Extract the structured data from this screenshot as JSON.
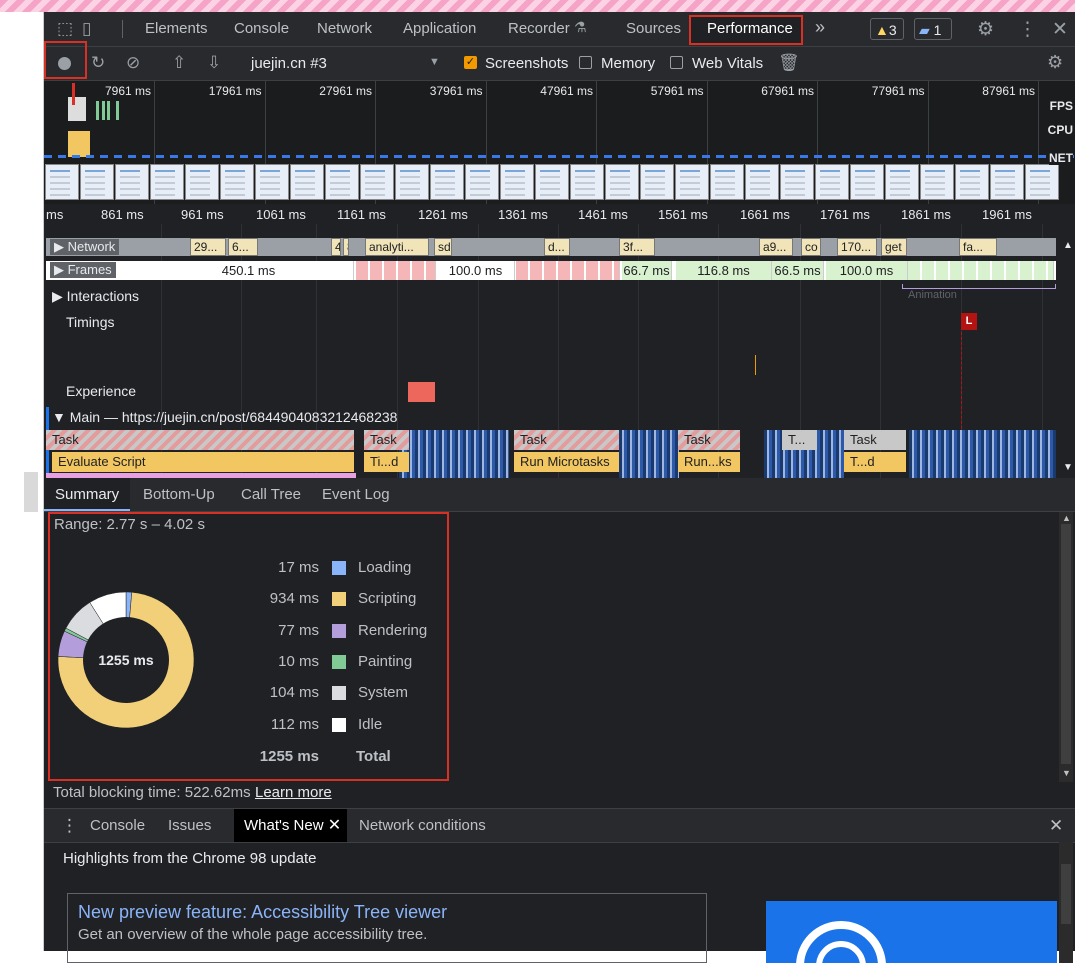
{
  "tabs": {
    "elements": "Elements",
    "console": "Console",
    "network": "Network",
    "application": "Application",
    "recorder": "Recorder",
    "recorder_icon": "flask-icon",
    "sources": "Sources",
    "performance": "Performance",
    "more": "»",
    "warnings_count": "3",
    "messages_count": "1"
  },
  "perf_toolbar": {
    "profile_select": "juejin.cn #3",
    "screenshots_label": "Screenshots",
    "screenshots_checked": true,
    "memory_label": "Memory",
    "memory_checked": false,
    "webvitals_label": "Web Vitals",
    "webvitals_checked": false
  },
  "overview": {
    "ticks": [
      "7961 ms",
      "17961 ms",
      "27961 ms",
      "37961 ms",
      "47961 ms",
      "57961 ms",
      "67961 ms",
      "77961 ms",
      "87961 ms"
    ],
    "labels": {
      "fps": "FPS",
      "cpu": "CPU",
      "net": "NET"
    }
  },
  "flame": {
    "ticks": [
      "ms",
      "861 ms",
      "961 ms",
      "1061 ms",
      "1161 ms",
      "1261 ms",
      "1361 ms",
      "1461 ms",
      "1561 ms",
      "1661 ms",
      "1761 ms",
      "1861 ms",
      "1961 ms"
    ],
    "network_label": "Network",
    "network_items": [
      "29...",
      "6...",
      "4",
      "8",
      "analyti...",
      "sd",
      "d...",
      "3f...",
      "a9...",
      "co",
      "170...",
      "get",
      "fa..."
    ],
    "frames_label": "Frames",
    "frames": [
      "450.1 ms",
      "100.0 ms",
      "66.7 ms",
      "116.8 ms",
      "66.5 ms",
      "100.0 ms"
    ],
    "animation_label": "Animation",
    "interactions_label": "Interactions",
    "timings_label": "Timings",
    "timing_marker": "L",
    "experience_label": "Experience",
    "main_label": "Main — https://juejin.cn/post/6844904083212468238",
    "tasks": [
      "Task",
      "Task",
      "Task",
      "Task",
      "T...",
      "Task"
    ],
    "events": [
      "Evaluate Script",
      "Ti...d",
      "Run Microtasks",
      "Run...ks",
      "T...d"
    ]
  },
  "bottom_tabs": [
    "Summary",
    "Bottom-Up",
    "Call Tree",
    "Event Log"
  ],
  "summary": {
    "range": "Range: 2.77 s – 4.02 s",
    "total_center": "1255 ms",
    "legend": [
      {
        "value": "17 ms",
        "name": "Loading",
        "color": "#8ab4f8",
        "ms": 17
      },
      {
        "value": "934 ms",
        "name": "Scripting",
        "color": "#f2d07a",
        "ms": 934
      },
      {
        "value": "77 ms",
        "name": "Rendering",
        "color": "#b39ddb",
        "ms": 77
      },
      {
        "value": "10 ms",
        "name": "Painting",
        "color": "#81c995",
        "ms": 10
      },
      {
        "value": "104 ms",
        "name": "System",
        "color": "#dadce0",
        "ms": 104
      },
      {
        "value": "112 ms",
        "name": "Idle",
        "color": "#ffffff",
        "ms": 112
      }
    ],
    "total_value": "1255 ms",
    "total_label": "Total",
    "tbt": "Total blocking time: 522.62ms",
    "learn_more": "Learn more"
  },
  "drawer": {
    "tabs": [
      "Console",
      "Issues",
      "What's New",
      "Network conditions"
    ],
    "highlights": "Highlights from the Chrome 98 update",
    "card_title": "New preview feature: Accessibility Tree viewer",
    "card_desc": "Get an overview of the whole page accessibility tree."
  }
}
